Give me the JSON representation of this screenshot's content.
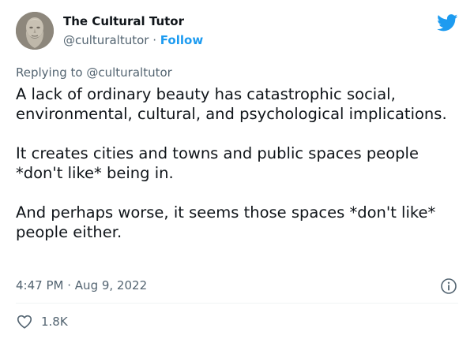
{
  "author": {
    "name": "The Cultural Tutor",
    "handle": "@culturaltutor",
    "separator": "·",
    "follow_label": "Follow"
  },
  "reply": {
    "prefix": "Replying to",
    "mention": "@culturaltutor"
  },
  "tweet": {
    "paragraphs": [
      "A lack of ordinary beauty has catastrophic social, environmental, cultural, and psychological implications.",
      "It creates cities and towns and public spaces people *don't like* being in.",
      "And perhaps worse, it seems those spaces *don't like* people either."
    ]
  },
  "meta": {
    "time": "4:47 PM",
    "separator": "·",
    "date": "Aug 9, 2022"
  },
  "actions": {
    "likes_count": "1.8K"
  },
  "colors": {
    "accent": "#1d9bf0",
    "secondary_text": "#536471",
    "primary_text": "#0f1419"
  },
  "icons": {
    "brand": "twitter-bird-icon",
    "info": "info-circle-icon",
    "like": "heart-outline-icon"
  }
}
